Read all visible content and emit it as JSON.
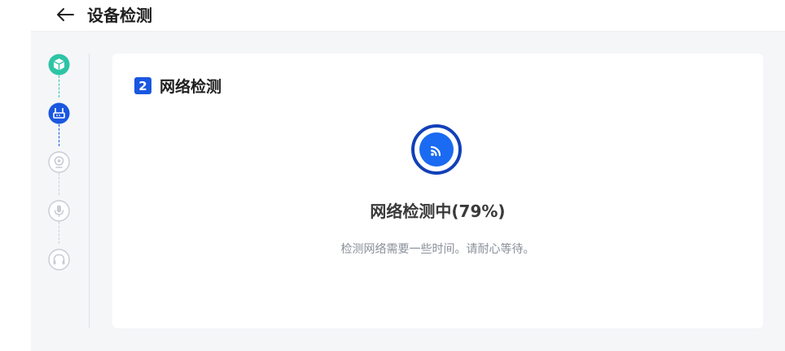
{
  "header": {
    "title": "设备检测",
    "back_icon": "arrow-left-icon"
  },
  "steps": [
    {
      "icon": "cube-icon",
      "state": "done",
      "color": "#2ec4a6"
    },
    {
      "icon": "router-icon",
      "state": "active",
      "color": "#1a57e0"
    },
    {
      "icon": "webcam-icon",
      "state": "pending"
    },
    {
      "icon": "microphone-icon",
      "state": "pending"
    },
    {
      "icon": "headphones-icon",
      "state": "pending"
    }
  ],
  "section": {
    "number": "2",
    "title": "网络检测"
  },
  "progress": {
    "percent": 79,
    "status_text": "网络检测中(79%)",
    "hint_text": "检测网络需要一些时间。请耐心等待。"
  },
  "colors": {
    "accent": "#1a57e0",
    "done": "#2ec4a6",
    "pending": "#c9ccd3"
  }
}
